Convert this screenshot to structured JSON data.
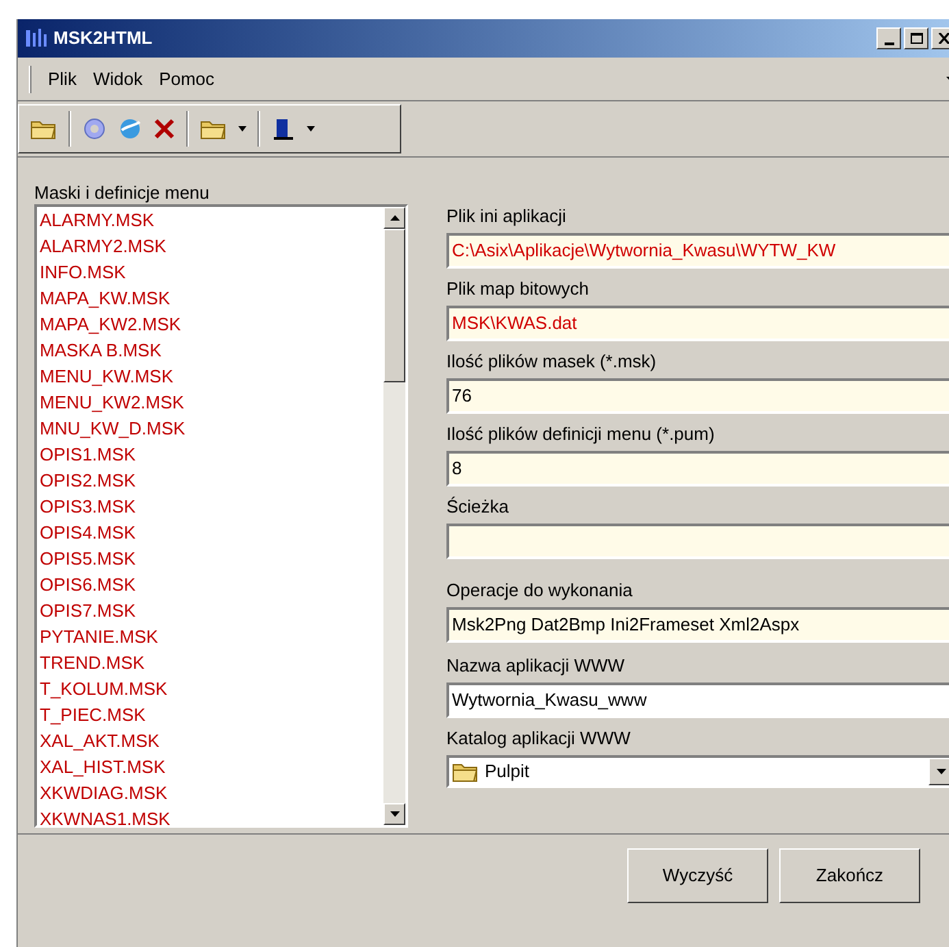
{
  "window": {
    "title": "MSK2HTML"
  },
  "menu": [
    "Plik",
    "Widok",
    "Pomoc"
  ],
  "list": {
    "label": "Maski i definicje menu",
    "items": [
      "ALARMY.MSK",
      "ALARMY2.MSK",
      "INFO.MSK",
      "MAPA_KW.MSK",
      "MAPA_KW2.MSK",
      "MASKA B.MSK",
      "MENU_KW.MSK",
      "MENU_KW2.MSK",
      "MNU_KW_D.MSK",
      "OPIS1.MSK",
      "OPIS2.MSK",
      "OPIS3.MSK",
      "OPIS4.MSK",
      "OPIS5.MSK",
      "OPIS6.MSK",
      "OPIS7.MSK",
      "PYTANIE.MSK",
      "TREND.MSK",
      "T_KOLUM.MSK",
      "T_PIEC.MSK",
      "XAL_AKT.MSK",
      "XAL_HIST.MSK",
      "XKWDIAG.MSK",
      "XKWNAS1.MSK"
    ]
  },
  "fields": [
    {
      "label": "Plik ini aplikacji",
      "value": "C:\\Asix\\Aplikacje\\Wytwornia_Kwasu\\WYTW_KW",
      "kind": "readonly",
      "color": "#d00000"
    },
    {
      "label": "Plik map bitowych",
      "value": "MSK\\KWAS.dat",
      "kind": "readonly",
      "color": "#d00000"
    },
    {
      "label": "Ilość plików masek (*.msk)",
      "value": "76",
      "kind": "readonly",
      "color": "#000000"
    },
    {
      "label": "Ilość plików definicji menu (*.pum)",
      "value": "8",
      "kind": "readonly",
      "color": "#000000"
    },
    {
      "label": "Ścieżka",
      "kind": "readonly"
    },
    {
      "label": "Operacje do wykonania",
      "value": "Msk2Png Dat2Bmp Ini2Frameset Xml2Aspx",
      "kind": "readonly",
      "color": "#000000"
    },
    {
      "label": "Nazwa aplikacji WWW",
      "value": "Wytwornia_Kwasu_www",
      "kind": "edit",
      "color": "#000000"
    },
    {
      "label": "Katalog aplikacji WWW",
      "value": "Pulpit",
      "kind": "combo",
      "color": "#000000"
    }
  ],
  "buttons": [
    "Wyczyść",
    "Zakończ"
  ]
}
